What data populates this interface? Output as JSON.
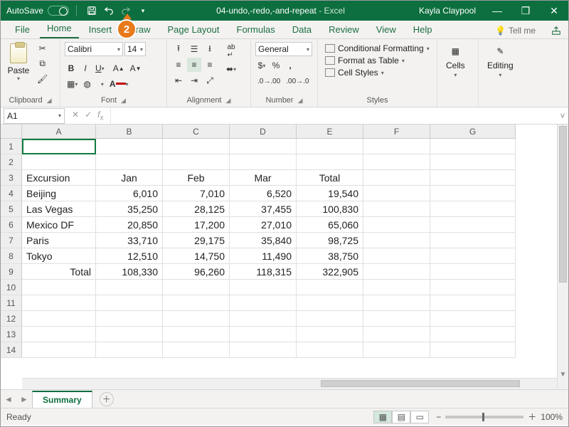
{
  "title": {
    "autosave": "AutoSave",
    "autosave_state": "Off",
    "doc": "04-undo,-redo,-and-repeat",
    "app": "Excel",
    "user": "Kayla Claypool"
  },
  "callout": {
    "number": "2"
  },
  "tabs": {
    "file": "File",
    "home": "Home",
    "insert": "Insert",
    "draw": "Draw",
    "pageLayout": "Page Layout",
    "formulas": "Formulas",
    "data": "Data",
    "review": "Review",
    "view": "View",
    "help": "Help",
    "tellme": "Tell me"
  },
  "ribbon": {
    "clipboard": {
      "paste": "Paste",
      "label": "Clipboard"
    },
    "font": {
      "name": "Calibri",
      "size": "14",
      "label": "Font",
      "fill": "#ffff00",
      "color": "#c00000"
    },
    "alignment": {
      "label": "Alignment"
    },
    "number": {
      "format": "General",
      "label": "Number"
    },
    "styles": {
      "cond": "Conditional Formatting",
      "table": "Format as Table",
      "cell": "Cell Styles",
      "label": "Styles"
    },
    "cells": {
      "label": "Cells"
    },
    "editing": {
      "label": "Editing"
    }
  },
  "namebox": "A1",
  "columns": [
    "A",
    "B",
    "C",
    "D",
    "E",
    "F",
    "G"
  ],
  "rows": [
    "1",
    "2",
    "3",
    "4",
    "5",
    "6",
    "7",
    "8",
    "9",
    "10",
    "11",
    "12",
    "13",
    "14"
  ],
  "grid": {
    "r3": {
      "A": "Excursion",
      "B": "Jan",
      "C": "Feb",
      "D": "Mar",
      "E": "Total"
    },
    "r4": {
      "A": "Beijing",
      "B": "6,010",
      "C": "7,010",
      "D": "6,520",
      "E": "19,540"
    },
    "r5": {
      "A": "Las Vegas",
      "B": "35,250",
      "C": "28,125",
      "D": "37,455",
      "E": "100,830"
    },
    "r6": {
      "A": "Mexico DF",
      "B": "20,850",
      "C": "17,200",
      "D": "27,010",
      "E": "65,060"
    },
    "r7": {
      "A": "Paris",
      "B": "33,710",
      "C": "29,175",
      "D": "35,840",
      "E": "98,725"
    },
    "r8": {
      "A": "Tokyo",
      "B": "12,510",
      "C": "14,750",
      "D": "11,490",
      "E": "38,750"
    },
    "r9": {
      "A": "Total",
      "B": "108,330",
      "C": "96,260",
      "D": "118,315",
      "E": "322,905"
    }
  },
  "sheet": {
    "name": "Summary"
  },
  "status": {
    "ready": "Ready",
    "zoom": "100%"
  }
}
